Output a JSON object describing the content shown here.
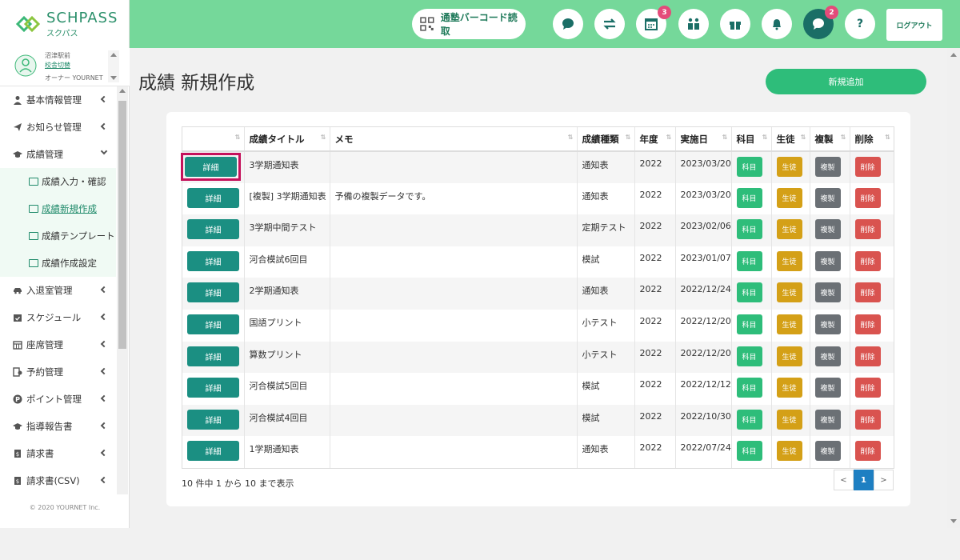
{
  "header": {
    "logo_text": "SCHPASS",
    "logo_sub": "スクパス",
    "barcode_label": "通塾バーコード読取",
    "calendar_badge": "3",
    "chat_badge": "2",
    "help_label": "?",
    "logout_label": "ログアウト"
  },
  "user": {
    "name": "沼津駅前",
    "switch_label": "校舎切替",
    "role": "オーナー YOURNET"
  },
  "sidebar": {
    "items": [
      {
        "label": "基本情報管理"
      },
      {
        "label": "お知らせ管理"
      },
      {
        "label": "成績管理"
      },
      {
        "label": "入退室管理"
      },
      {
        "label": "スケジュール"
      },
      {
        "label": "座席管理"
      },
      {
        "label": "予約管理"
      },
      {
        "label": "ポイント管理"
      },
      {
        "label": "指導報告書"
      },
      {
        "label": "請求書"
      },
      {
        "label": "請求書(CSV)"
      }
    ],
    "sub_items": [
      {
        "label": "成績入力・確認"
      },
      {
        "label": "成績新規作成"
      },
      {
        "label": "成績テンプレート"
      },
      {
        "label": "成績作成設定"
      }
    ],
    "copyright": "© 2020 YOURNET Inc."
  },
  "main": {
    "title": "成績 新規作成",
    "add_label": "新規追加",
    "columns": [
      "",
      "成績タイトル",
      "メモ",
      "成績種類",
      "年度",
      "実施日",
      "科目",
      "生徒",
      "複製",
      "削除"
    ],
    "button_labels": {
      "detail": "詳細",
      "subject": "科目",
      "student": "生徒",
      "copy": "複製",
      "delete": "削除"
    },
    "rows": [
      {
        "title": "3学期通知表",
        "memo": "",
        "type": "通知表",
        "year": "2022",
        "date": "2023/03/20"
      },
      {
        "title": "[複製] 3学期通知表",
        "memo": "予備の複製データです。",
        "type": "通知表",
        "year": "2022",
        "date": "2023/03/20"
      },
      {
        "title": "3学期中間テスト",
        "memo": "",
        "type": "定期テスト",
        "year": "2022",
        "date": "2023/02/06"
      },
      {
        "title": "河合模試6回目",
        "memo": "",
        "type": "模試",
        "year": "2022",
        "date": "2023/01/07"
      },
      {
        "title": "2学期通知表",
        "memo": "",
        "type": "通知表",
        "year": "2022",
        "date": "2022/12/24"
      },
      {
        "title": "国語プリント",
        "memo": "",
        "type": "小テスト",
        "year": "2022",
        "date": "2022/12/20"
      },
      {
        "title": "算数プリント",
        "memo": "",
        "type": "小テスト",
        "year": "2022",
        "date": "2022/12/20"
      },
      {
        "title": "河合模試5回目",
        "memo": "",
        "type": "模試",
        "year": "2022",
        "date": "2022/12/12"
      },
      {
        "title": "河合模試4回目",
        "memo": "",
        "type": "模試",
        "year": "2022",
        "date": "2022/10/30"
      },
      {
        "title": "1学期通知表",
        "memo": "",
        "type": "通知表",
        "year": "2022",
        "date": "2022/07/24"
      }
    ],
    "info": "10 件中 1 から 10 まで表示",
    "pager": {
      "prev": "<",
      "current": "1",
      "next": ">"
    }
  },
  "colors": {
    "header_bg": "#75d89a",
    "detail": "#1b8f82",
    "subject": "#2ebd7a",
    "student": "#d4a017",
    "copy": "#6b7075",
    "delete": "#d9534f",
    "highlight": "#c4125b"
  }
}
